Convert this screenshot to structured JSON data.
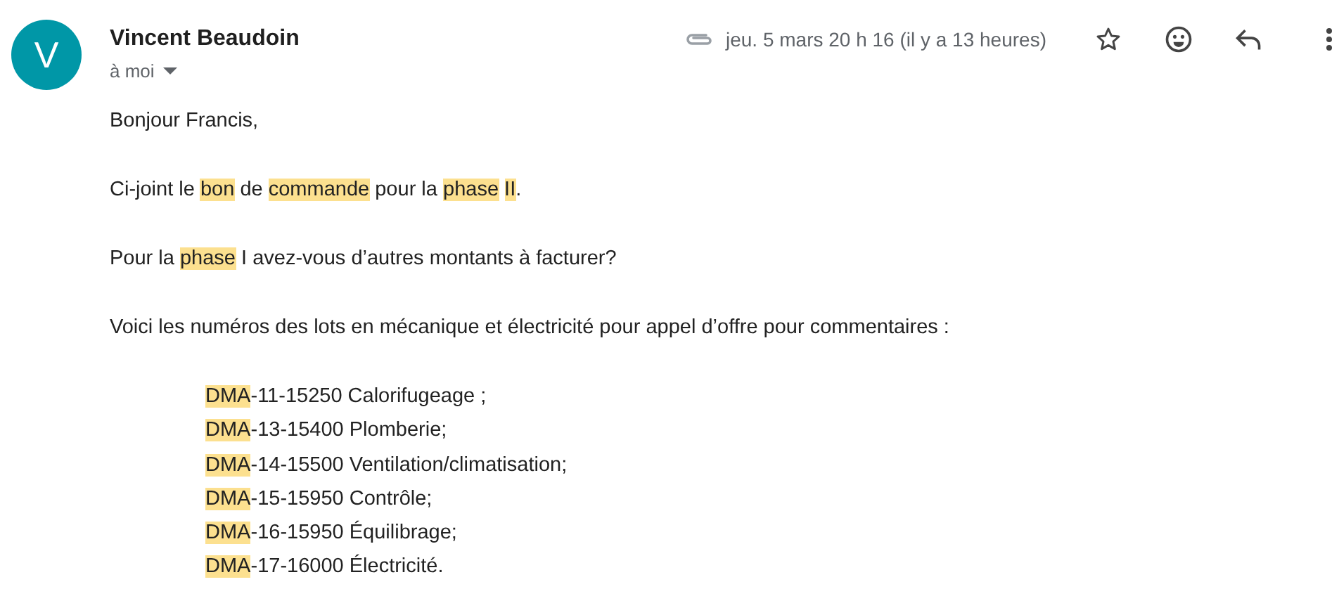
{
  "sender": {
    "initial": "V",
    "name": "Vincent Beaudoin",
    "recipient": "à moi"
  },
  "meta": {
    "has_attachment": true,
    "date": "jeu. 5 mars 20 h 16 (il y a 13 heures)",
    "starred": false
  },
  "body": {
    "paragraphs": [
      [
        {
          "text": "Bonjour Francis,",
          "highlighted": false
        }
      ],
      [
        {
          "text": "Ci-joint le ",
          "highlighted": false
        },
        {
          "text": "bon",
          "highlighted": true
        },
        {
          "text": " de ",
          "highlighted": false
        },
        {
          "text": "commande",
          "highlighted": true
        },
        {
          "text": " pour la ",
          "highlighted": false
        },
        {
          "text": "phase",
          "highlighted": true
        },
        {
          "text": "II",
          "highlighted": true,
          "space_before": true
        },
        {
          "text": ".",
          "highlighted": false
        }
      ],
      [
        {
          "text": "Pour la ",
          "highlighted": false
        },
        {
          "text": "phase",
          "highlighted": true
        },
        {
          "text": " I avez-vous d’autres montants à facturer?",
          "highlighted": false
        }
      ],
      [
        {
          "text": "Voici les numéros des lots en mécanique et électricité pour appel d’offre pour commentaires :",
          "highlighted": false
        }
      ]
    ],
    "lots": [
      [
        {
          "text": "DMA",
          "highlighted": true
        },
        {
          "text": "-11-15250 Calorifugeage ;",
          "highlighted": false
        }
      ],
      [
        {
          "text": "DMA",
          "highlighted": true
        },
        {
          "text": "-13-15400 Plomberie;",
          "highlighted": false
        }
      ],
      [
        {
          "text": "DMA",
          "highlighted": true
        },
        {
          "text": "-14-15500 Ventilation/climatisation;",
          "highlighted": false
        }
      ],
      [
        {
          "text": "DMA",
          "highlighted": true
        },
        {
          "text": "-15-15950 Contrôle;",
          "highlighted": false
        }
      ],
      [
        {
          "text": "DMA",
          "highlighted": true
        },
        {
          "text": "-16-15950 Équilibrage;",
          "highlighted": false
        }
      ],
      [
        {
          "text": "DMA",
          "highlighted": true
        },
        {
          "text": "-17-16000 Électricité.",
          "highlighted": false
        }
      ]
    ]
  }
}
